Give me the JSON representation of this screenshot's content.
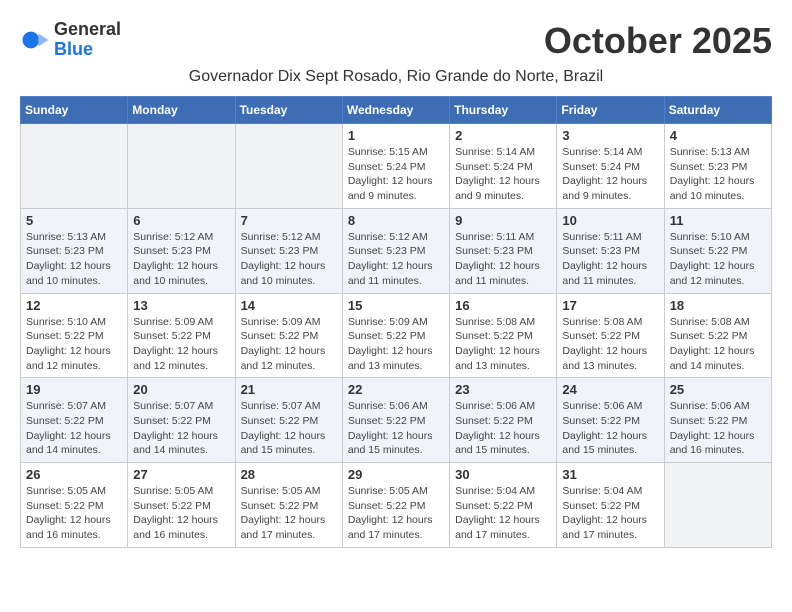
{
  "header": {
    "logo_line1": "General",
    "logo_line2": "Blue",
    "month_title": "October 2025",
    "location": "Governador Dix Sept Rosado, Rio Grande do Norte, Brazil"
  },
  "weekdays": [
    "Sunday",
    "Monday",
    "Tuesday",
    "Wednesday",
    "Thursday",
    "Friday",
    "Saturday"
  ],
  "weeks": [
    [
      {
        "day": "",
        "info": ""
      },
      {
        "day": "",
        "info": ""
      },
      {
        "day": "",
        "info": ""
      },
      {
        "day": "1",
        "info": "Sunrise: 5:15 AM\nSunset: 5:24 PM\nDaylight: 12 hours and 9 minutes."
      },
      {
        "day": "2",
        "info": "Sunrise: 5:14 AM\nSunset: 5:24 PM\nDaylight: 12 hours and 9 minutes."
      },
      {
        "day": "3",
        "info": "Sunrise: 5:14 AM\nSunset: 5:24 PM\nDaylight: 12 hours and 9 minutes."
      },
      {
        "day": "4",
        "info": "Sunrise: 5:13 AM\nSunset: 5:23 PM\nDaylight: 12 hours and 10 minutes."
      }
    ],
    [
      {
        "day": "5",
        "info": "Sunrise: 5:13 AM\nSunset: 5:23 PM\nDaylight: 12 hours and 10 minutes."
      },
      {
        "day": "6",
        "info": "Sunrise: 5:12 AM\nSunset: 5:23 PM\nDaylight: 12 hours and 10 minutes."
      },
      {
        "day": "7",
        "info": "Sunrise: 5:12 AM\nSunset: 5:23 PM\nDaylight: 12 hours and 10 minutes."
      },
      {
        "day": "8",
        "info": "Sunrise: 5:12 AM\nSunset: 5:23 PM\nDaylight: 12 hours and 11 minutes."
      },
      {
        "day": "9",
        "info": "Sunrise: 5:11 AM\nSunset: 5:23 PM\nDaylight: 12 hours and 11 minutes."
      },
      {
        "day": "10",
        "info": "Sunrise: 5:11 AM\nSunset: 5:23 PM\nDaylight: 12 hours and 11 minutes."
      },
      {
        "day": "11",
        "info": "Sunrise: 5:10 AM\nSunset: 5:22 PM\nDaylight: 12 hours and 12 minutes."
      }
    ],
    [
      {
        "day": "12",
        "info": "Sunrise: 5:10 AM\nSunset: 5:22 PM\nDaylight: 12 hours and 12 minutes."
      },
      {
        "day": "13",
        "info": "Sunrise: 5:09 AM\nSunset: 5:22 PM\nDaylight: 12 hours and 12 minutes."
      },
      {
        "day": "14",
        "info": "Sunrise: 5:09 AM\nSunset: 5:22 PM\nDaylight: 12 hours and 12 minutes."
      },
      {
        "day": "15",
        "info": "Sunrise: 5:09 AM\nSunset: 5:22 PM\nDaylight: 12 hours and 13 minutes."
      },
      {
        "day": "16",
        "info": "Sunrise: 5:08 AM\nSunset: 5:22 PM\nDaylight: 12 hours and 13 minutes."
      },
      {
        "day": "17",
        "info": "Sunrise: 5:08 AM\nSunset: 5:22 PM\nDaylight: 12 hours and 13 minutes."
      },
      {
        "day": "18",
        "info": "Sunrise: 5:08 AM\nSunset: 5:22 PM\nDaylight: 12 hours and 14 minutes."
      }
    ],
    [
      {
        "day": "19",
        "info": "Sunrise: 5:07 AM\nSunset: 5:22 PM\nDaylight: 12 hours and 14 minutes."
      },
      {
        "day": "20",
        "info": "Sunrise: 5:07 AM\nSunset: 5:22 PM\nDaylight: 12 hours and 14 minutes."
      },
      {
        "day": "21",
        "info": "Sunrise: 5:07 AM\nSunset: 5:22 PM\nDaylight: 12 hours and 15 minutes."
      },
      {
        "day": "22",
        "info": "Sunrise: 5:06 AM\nSunset: 5:22 PM\nDaylight: 12 hours and 15 minutes."
      },
      {
        "day": "23",
        "info": "Sunrise: 5:06 AM\nSunset: 5:22 PM\nDaylight: 12 hours and 15 minutes."
      },
      {
        "day": "24",
        "info": "Sunrise: 5:06 AM\nSunset: 5:22 PM\nDaylight: 12 hours and 15 minutes."
      },
      {
        "day": "25",
        "info": "Sunrise: 5:06 AM\nSunset: 5:22 PM\nDaylight: 12 hours and 16 minutes."
      }
    ],
    [
      {
        "day": "26",
        "info": "Sunrise: 5:05 AM\nSunset: 5:22 PM\nDaylight: 12 hours and 16 minutes."
      },
      {
        "day": "27",
        "info": "Sunrise: 5:05 AM\nSunset: 5:22 PM\nDaylight: 12 hours and 16 minutes."
      },
      {
        "day": "28",
        "info": "Sunrise: 5:05 AM\nSunset: 5:22 PM\nDaylight: 12 hours and 17 minutes."
      },
      {
        "day": "29",
        "info": "Sunrise: 5:05 AM\nSunset: 5:22 PM\nDaylight: 12 hours and 17 minutes."
      },
      {
        "day": "30",
        "info": "Sunrise: 5:04 AM\nSunset: 5:22 PM\nDaylight: 12 hours and 17 minutes."
      },
      {
        "day": "31",
        "info": "Sunrise: 5:04 AM\nSunset: 5:22 PM\nDaylight: 12 hours and 17 minutes."
      },
      {
        "day": "",
        "info": ""
      }
    ]
  ]
}
